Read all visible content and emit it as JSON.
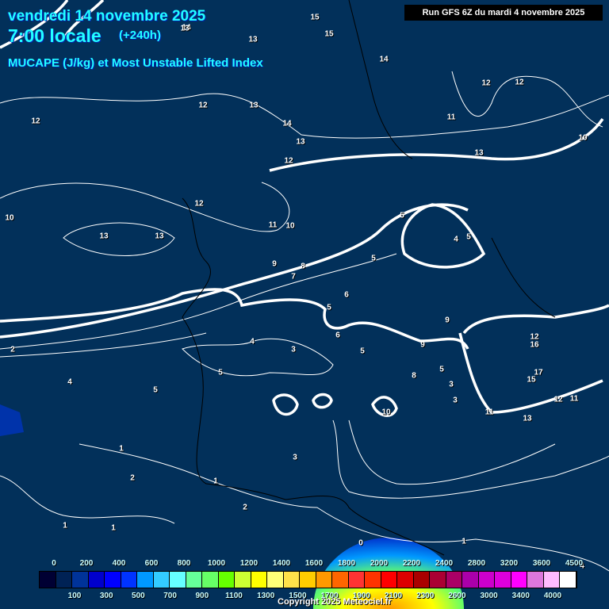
{
  "header": {
    "date": "vendredi 14 novembre 2025",
    "time": "7:00 locale",
    "lead": "(+240h)",
    "parameter": "MUCAPE (J/kg) et Most Unstable Lifted Index",
    "run": "Run GFS 6Z du mardi 4 novembre 2025"
  },
  "contour_labels": [
    "15",
    "15",
    "14",
    "13",
    "13",
    "14",
    "12",
    "12",
    "13",
    "12",
    "14",
    "13",
    "12",
    "11",
    "10",
    "9",
    "8",
    "7",
    "12",
    "13",
    "13",
    "10",
    "5",
    "4",
    "5",
    "5",
    "5",
    "6",
    "5",
    "4",
    "3",
    "4",
    "5",
    "2",
    "6",
    "5",
    "9",
    "9",
    "8",
    "5",
    "3",
    "3",
    "12",
    "16",
    "17",
    "15",
    "12",
    "11",
    "13",
    "10",
    "11",
    "12",
    "11",
    "13",
    "10",
    "1",
    "2",
    "1",
    "1",
    "2",
    "1",
    "3",
    "0",
    "1",
    "4"
  ],
  "colorbar": {
    "colors": [
      "#000033",
      "#002255",
      "#003399",
      "#0000cc",
      "#0000ff",
      "#0033ff",
      "#0099ff",
      "#33ccff",
      "#66ffff",
      "#66ff99",
      "#66ff66",
      "#66ff00",
      "#ccff33",
      "#ffff00",
      "#ffff77",
      "#ffe14a",
      "#ffcc00",
      "#ff9900",
      "#ff6600",
      "#ff3333",
      "#ff3300",
      "#ff0000",
      "#dd0000",
      "#aa0000",
      "#aa0033",
      "#aa0066",
      "#aa00aa",
      "#cc00cc",
      "#dd00dd",
      "#ff00ff",
      "#dd77dd",
      "#ffbbff",
      "#ffffff"
    ],
    "top_labels": [
      "0",
      "200",
      "400",
      "600",
      "800",
      "1000",
      "1200",
      "1400",
      "1600",
      "1800",
      "2000",
      "2200",
      "2400",
      "2800",
      "3200",
      "3600",
      "4500"
    ],
    "bottom_labels": [
      "100",
      "300",
      "500",
      "700",
      "900",
      "1100",
      "1300",
      "1500",
      "1700",
      "1900",
      "2100",
      "2300",
      "2600",
      "3000",
      "3400",
      "4000"
    ]
  },
  "copyright": "Copyright 2025 Meteociel.fr"
}
